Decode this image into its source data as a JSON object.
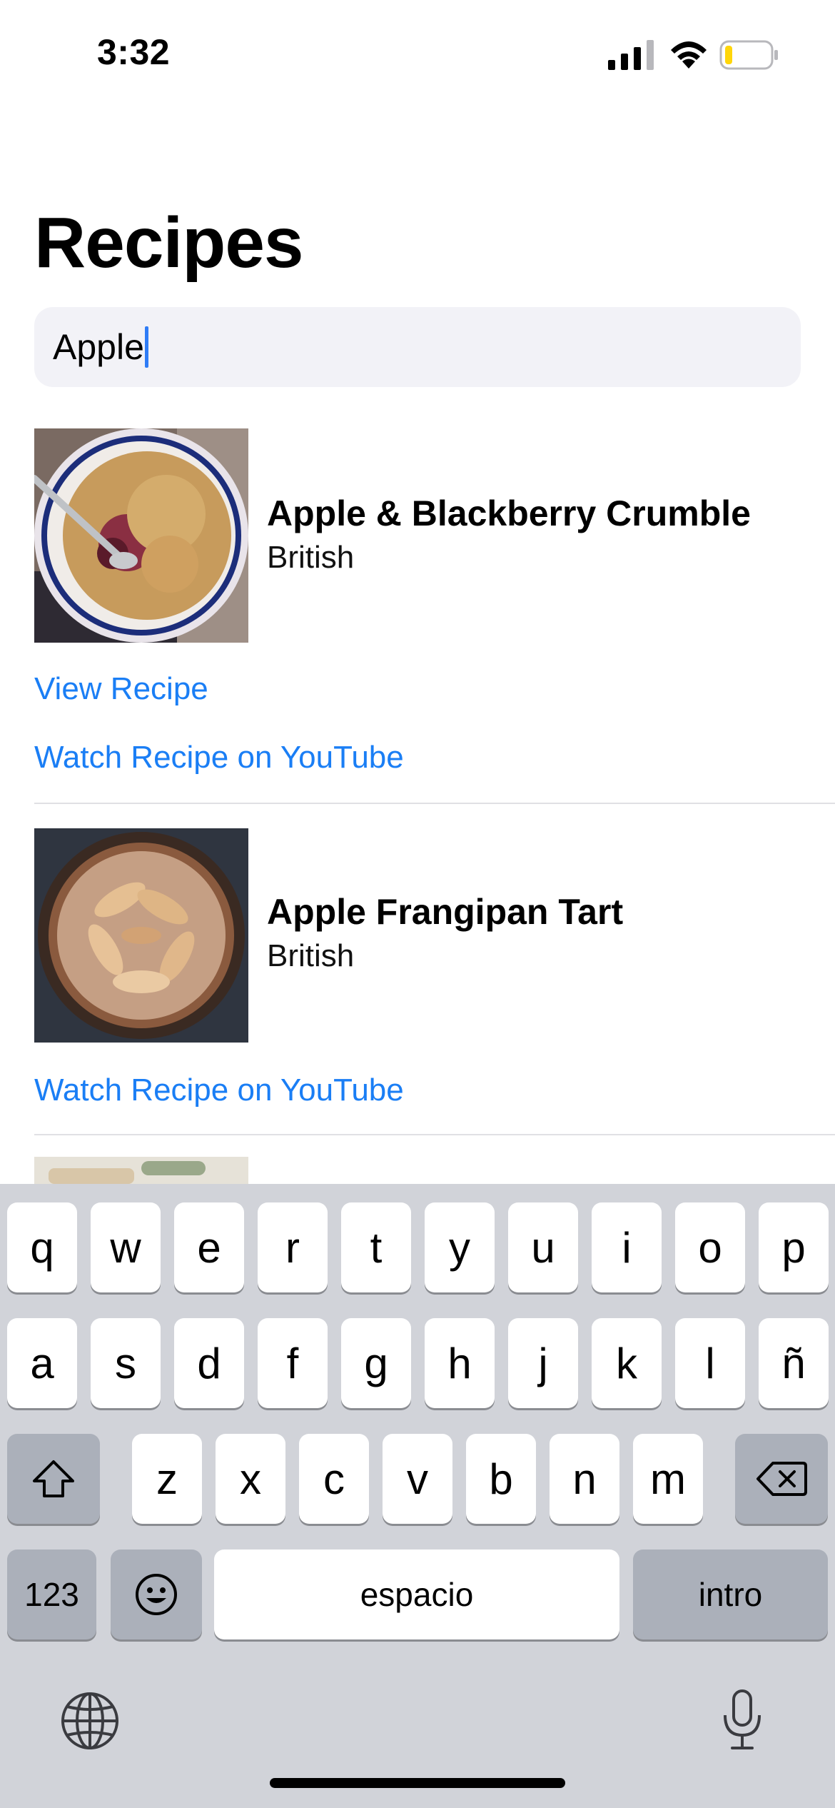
{
  "status_bar": {
    "time": "3:32",
    "signal_icon": "cellular-signal-icon",
    "wifi_icon": "wifi-icon",
    "battery_icon": "battery-low-icon",
    "battery_level": 0.15
  },
  "page": {
    "title": "Recipes"
  },
  "search": {
    "value": "Apple",
    "placeholder": ""
  },
  "recipes": [
    {
      "title": "Apple & Blackberry Crumble",
      "cuisine": "British",
      "links": [
        "View Recipe",
        "Watch Recipe on YouTube"
      ]
    },
    {
      "title": "Apple Frangipan Tart",
      "cuisine": "British",
      "links": [
        "Watch Recipe on YouTube"
      ]
    }
  ],
  "keyboard": {
    "row1": [
      "q",
      "w",
      "e",
      "r",
      "t",
      "y",
      "u",
      "i",
      "o",
      "p"
    ],
    "row2": [
      "a",
      "s",
      "d",
      "f",
      "g",
      "h",
      "j",
      "k",
      "l",
      "ñ"
    ],
    "row3": [
      "z",
      "x",
      "c",
      "v",
      "b",
      "n",
      "m"
    ],
    "numbers_key": "123",
    "space_key": "espacio",
    "return_key": "intro",
    "shift_icon": "shift-icon",
    "delete_icon": "delete-backspace-icon",
    "emoji_icon": "emoji-icon",
    "globe_icon": "globe-icon",
    "mic_icon": "microphone-icon"
  },
  "colors": {
    "link": "#1a7ef5",
    "caret": "#2f7cf6",
    "battery_fill": "#ffd60a",
    "keyboard_bg": "#d1d3d9"
  }
}
